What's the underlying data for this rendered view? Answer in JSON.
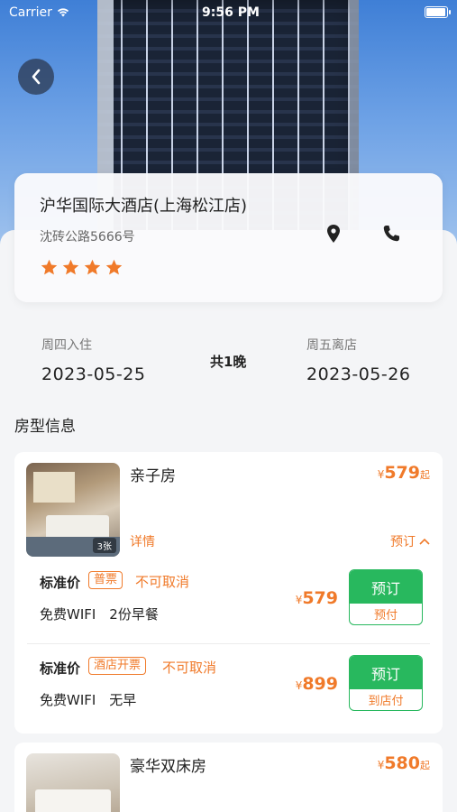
{
  "status_bar": {
    "carrier": "Carrier",
    "time": "9:56 PM"
  },
  "hotel": {
    "name": "沪华国际大酒店(上海松江店)",
    "address": "沈砖公路5666号",
    "star_rating": 4
  },
  "stay": {
    "checkin_label": "周四入住",
    "checkin_date": "2023-05-25",
    "nights": "共1晚",
    "checkout_label": "周五离店",
    "checkout_date": "2023-05-26"
  },
  "section_title": "房型信息",
  "rooms": [
    {
      "name": "亲子房",
      "currency": "¥",
      "from_price": "579",
      "from_suffix": "起",
      "photo_count": "3张",
      "details_label": "详情",
      "book_toggle_label": "预订",
      "rates": [
        {
          "title": "标准价",
          "invoice": "普票",
          "cancel": "不可取消",
          "perks": "免费WIFI　2份早餐",
          "currency": "¥",
          "price": "579",
          "book_label": "预订",
          "pay_label": "预付"
        },
        {
          "title": "标准价",
          "invoice": "酒店开票",
          "cancel": "不可取消",
          "perks": "免费WIFI　无早",
          "currency": "¥",
          "price": "899",
          "book_label": "预订",
          "pay_label": "到店付"
        }
      ]
    },
    {
      "name": "豪华双床房",
      "currency": "¥",
      "from_price": "580",
      "from_suffix": "起"
    }
  ],
  "colors": {
    "accent": "#f07a2a",
    "book_green": "#28b85e"
  },
  "icons": [
    "wifi-icon",
    "battery-icon",
    "back-arrow-icon",
    "location-pin-icon",
    "phone-icon",
    "star-icon",
    "chevron-up-icon"
  ]
}
